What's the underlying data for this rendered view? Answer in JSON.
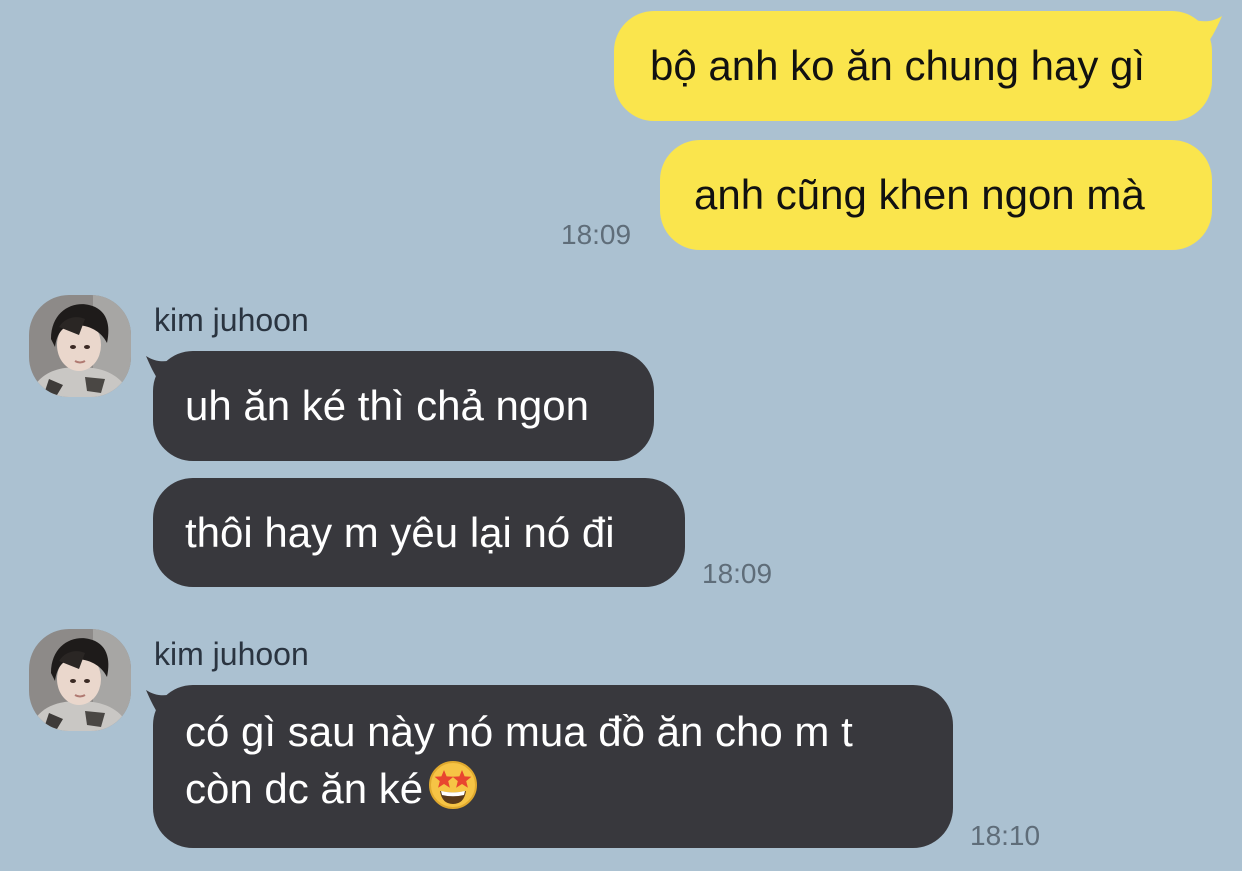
{
  "colors": {
    "background": "#abc1d1",
    "outgoing_bubble": "#fae54d",
    "incoming_bubble": "#38383d",
    "timestamp": "#5f6d79"
  },
  "messages": {
    "out1": {
      "text": "bộ anh ko ăn chung hay gì"
    },
    "out2": {
      "text": "anh cũng khen ngon mà",
      "time": "18:09"
    },
    "group1": {
      "sender": "kim juhoon",
      "avatar_icon": "profile-photo",
      "msg1": "uh ăn ké thì chả ngon",
      "msg2": "thôi hay m yêu lại nó đi",
      "time": "18:09"
    },
    "group2": {
      "sender": "kim juhoon",
      "avatar_icon": "profile-photo",
      "line1": "có gì sau này nó mua đồ ăn cho m t",
      "line2": "còn dc ăn ké",
      "emoji": "star-struck-emoji",
      "time": "18:10"
    }
  }
}
